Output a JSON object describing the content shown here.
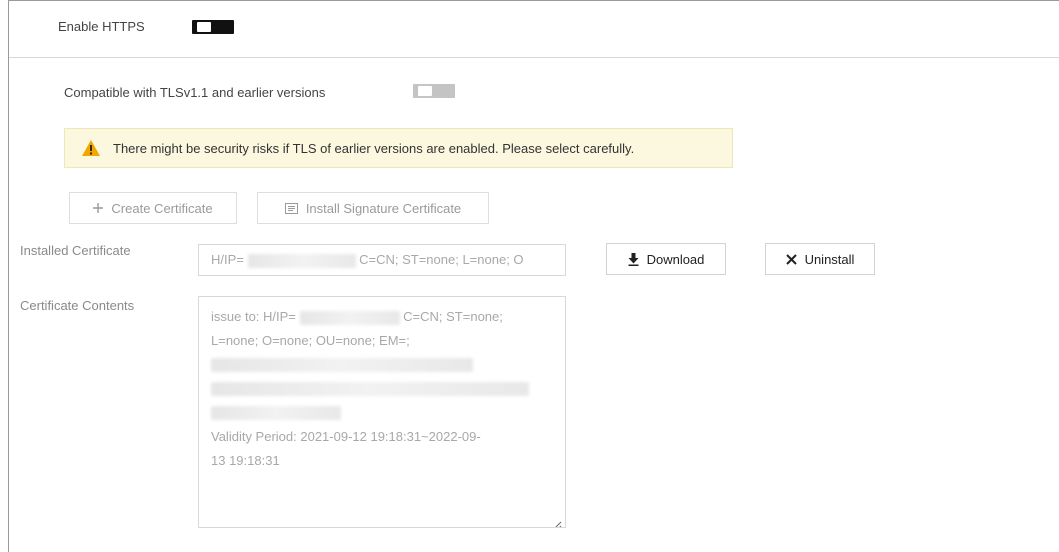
{
  "https": {
    "label": "Enable HTTPS",
    "enabled": true
  },
  "tls_compat": {
    "label": "Compatible with TLSv1.1 and earlier versions",
    "enabled": false
  },
  "warning": {
    "text": "There might be security risks if TLS of earlier versions are enabled. Please select carefully.",
    "icon": "warning-triangle-icon"
  },
  "buttons": {
    "create_certificate": "Create Certificate",
    "install_signature": "Install Signature Certificate",
    "download": "Download",
    "uninstall": "Uninstall"
  },
  "installed_certificate": {
    "label": "Installed Certificate",
    "prefix": "H/IP=",
    "suffix": "C=CN; ST=none; L=none; O"
  },
  "certificate_contents": {
    "label": "Certificate Contents",
    "line1_prefix": "issue to: H/IP=",
    "line1_suffix": "C=CN; ST=none;",
    "line2": "L=none; O=none; OU=none; EM=;",
    "line6": "Validity Period: 2021-09-12 19:18:31~2022-09-",
    "line7": "13 19:18:31"
  },
  "colors": {
    "toggle_on": "#111111",
    "toggle_off": "#c4c4c4",
    "warning_bg": "#fbf8df",
    "warning_icon": "#f0a800"
  }
}
